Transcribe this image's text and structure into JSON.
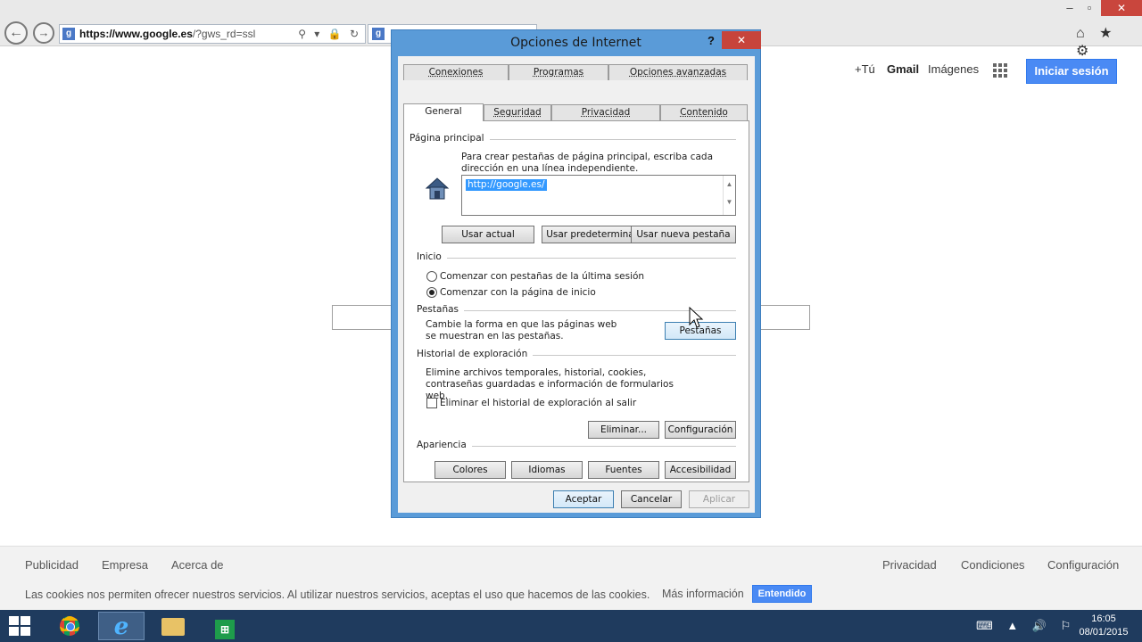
{
  "browser": {
    "address_host": "https://www.google.es",
    "address_path": "/?gws_rd=ssl",
    "address_icons": "⚲ ▾ 🔒 ↻",
    "tab_favicon": "g",
    "window_controls": {
      "minimize": "–",
      "restore": "▫",
      "close": "✕"
    },
    "toolbar_icons": "⌂ ★ ⚙"
  },
  "google": {
    "top_links": {
      "plus_you": "+Tú",
      "gmail": "Gmail",
      "images": "Imágenes"
    },
    "signin_label": "Iniciar sesión",
    "footer_left": [
      "Publicidad",
      "Empresa",
      "Acerca de"
    ],
    "footer_right": [
      "Privacidad",
      "Condiciones",
      "Configuración"
    ],
    "cookie_text": "Las cookies nos permiten ofrecer nuestros servicios. Al utilizar nuestros servicios, aceptas el uso que hacemos de las cookies.",
    "cookie_more": "Más información",
    "cookie_button": "Entendido"
  },
  "dialog": {
    "title": "Opciones de Internet",
    "help": "?",
    "close": "✕",
    "tabs_back": [
      "Conexiones",
      "Programas",
      "Opciones avanzadas"
    ],
    "tabs_front": [
      "General",
      "Seguridad",
      "Privacidad",
      "Contenido"
    ],
    "home": {
      "section": "Página principal",
      "desc": "Para crear pestañas de página principal, escriba cada dirección en una línea independiente.",
      "url": "http://google.es/",
      "buttons": [
        "Usar actual",
        "Usar predeterminada",
        "Usar nueva pestaña"
      ]
    },
    "startup": {
      "section": "Inicio",
      "options": [
        "Comenzar con pestañas de la última sesión",
        "Comenzar con la página de inicio"
      ],
      "selected_index": 1
    },
    "tabs_section": {
      "section": "Pestañas",
      "desc": "Cambie la forma en que las páginas web se muestran en las pestañas.",
      "button": "Pestañas"
    },
    "history": {
      "section": "Historial de exploración",
      "desc": "Elimine archivos temporales, historial, cookies, contraseñas guardadas e información de formularios web.",
      "checkbox": "Eliminar el historial de exploración al salir",
      "checked": false,
      "buttons": [
        "Eliminar...",
        "Configuración"
      ]
    },
    "appearance": {
      "section": "Apariencia",
      "buttons": [
        "Colores",
        "Idiomas",
        "Fuentes",
        "Accesibilidad"
      ]
    },
    "footer_buttons": {
      "accept": "Aceptar",
      "cancel": "Cancelar",
      "apply": "Aplicar"
    }
  },
  "taskbar": {
    "store_label": "⊞",
    "tray_icons": "⌨ ▲ 🔊 ⚐",
    "time": "16:05",
    "date": "08/01/2015"
  }
}
